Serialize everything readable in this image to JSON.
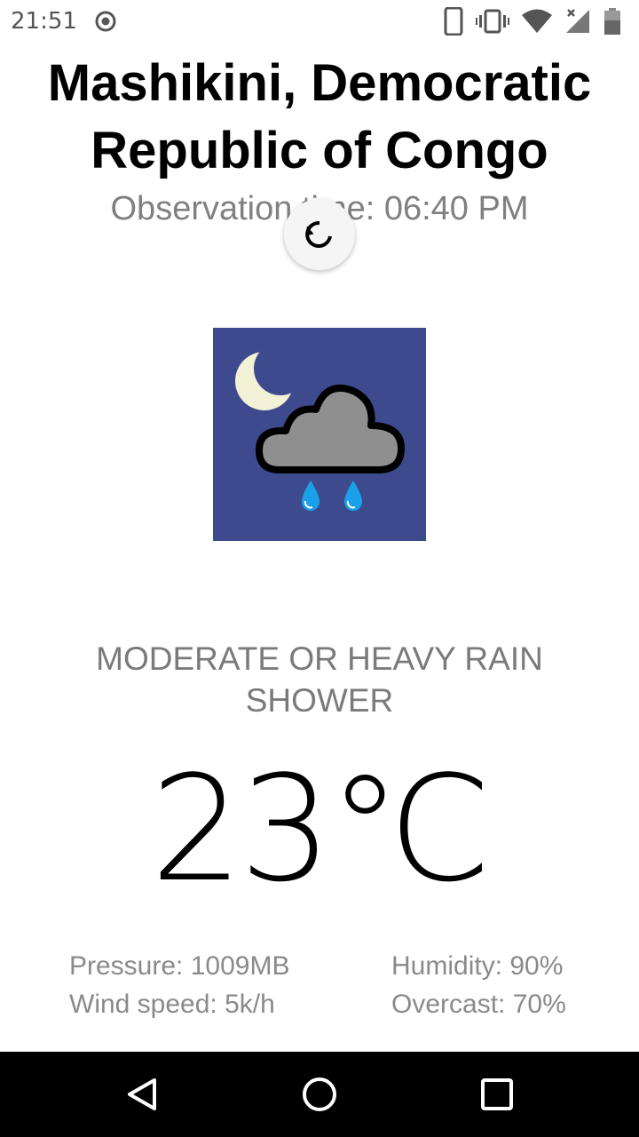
{
  "status_bar": {
    "time": "21:51",
    "icons": [
      "record-icon",
      "phone-icon",
      "vibrate-icon",
      "wifi-icon",
      "signal-icon",
      "battery-icon"
    ]
  },
  "header": {
    "location": "Mashikini, Democratic Republic of Congo",
    "observation_time": "Observation time: 06:40 PM"
  },
  "refresh": {
    "icon": "refresh-icon"
  },
  "weather": {
    "icon": "night-rain-shower-icon",
    "icon_bg_color": "#3e4a8e",
    "condition": "MODERATE OR HEAVY RAIN SHOWER",
    "temperature": "23℃"
  },
  "stats": {
    "pressure": "Pressure: 1009MB",
    "wind_speed": "Wind speed: 5k/h",
    "humidity": "Humidity: 90%",
    "overcast": "Overcast: 70%"
  },
  "nav": {
    "back": "back-icon",
    "home": "home-icon",
    "recents": "recents-icon"
  }
}
